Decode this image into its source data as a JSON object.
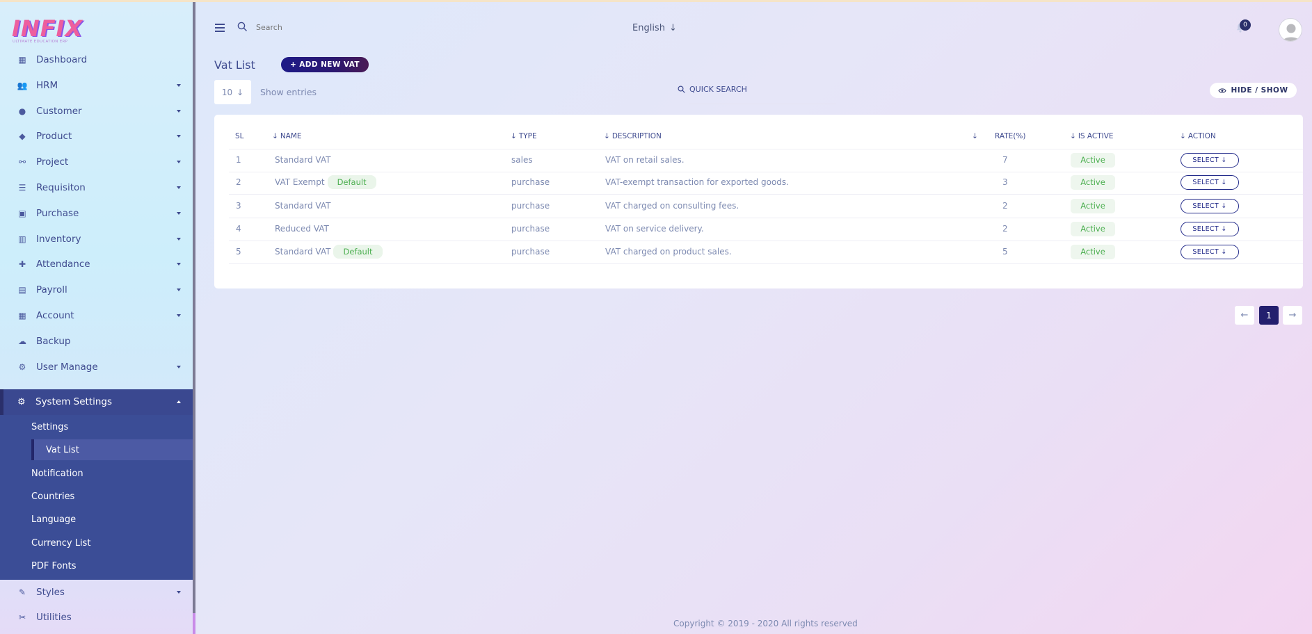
{
  "brand": {
    "logo_text": "INFIX",
    "tagline": "ULTIMATE EDUCATION ERP"
  },
  "sidebar": {
    "items": [
      {
        "label": "Dashboard",
        "icon": "grid-icon",
        "has_caret": false
      },
      {
        "label": "HRM",
        "icon": "users-icon",
        "has_caret": true
      },
      {
        "label": "Customer",
        "icon": "user-icon",
        "has_caret": true
      },
      {
        "label": "Product",
        "icon": "tags-icon",
        "has_caret": true
      },
      {
        "label": "Project",
        "icon": "project-diagram-icon",
        "has_caret": true
      },
      {
        "label": "Requisiton",
        "icon": "list-icon",
        "has_caret": true
      },
      {
        "label": "Purchase",
        "icon": "truck-loading-icon",
        "has_caret": true
      },
      {
        "label": "Inventory",
        "icon": "barcode-icon",
        "has_caret": true
      },
      {
        "label": "Attendance",
        "icon": "user-plus-icon",
        "has_caret": true
      },
      {
        "label": "Payroll",
        "icon": "money-icon",
        "has_caret": true
      },
      {
        "label": "Account",
        "icon": "calculator-icon",
        "has_caret": true
      },
      {
        "label": "Backup",
        "icon": "cloud-download-icon",
        "has_caret": false
      },
      {
        "label": "User Manage",
        "icon": "users-cog-icon",
        "has_caret": true
      }
    ],
    "system_settings": {
      "label": "System Settings",
      "icon": "gear-icon",
      "children": [
        "Settings",
        "Vat List",
        "Notification",
        "Countries",
        "Language",
        "Currency List",
        "PDF Fonts"
      ],
      "active_child": "Vat List"
    },
    "bottom_items": [
      {
        "label": "Styles",
        "icon": "paint-brush-icon",
        "has_caret": true
      },
      {
        "label": "Utilities",
        "icon": "tools-icon",
        "has_caret": false
      }
    ]
  },
  "header": {
    "search_placeholder": "Search",
    "language": "English",
    "notification_count": "0"
  },
  "main": {
    "title": "Vat List",
    "add_button": "+ ADD NEW VAT",
    "entries_value": "10",
    "show_entries": "Show entries",
    "quick_search": "QUICK SEARCH",
    "hide_show": "HIDE / SHOW"
  },
  "table": {
    "columns": [
      "SL",
      "NAME",
      "TYPE",
      "DESCRIPTION",
      "",
      "RATE(%)",
      "IS ACTIVE",
      "ACTION"
    ],
    "rows": [
      {
        "sl": "1",
        "name": "Standard VAT",
        "default": false,
        "type": "sales",
        "description": "VAT on retail sales.",
        "rate": "7",
        "status": "Active",
        "action": "SELECT"
      },
      {
        "sl": "2",
        "name": "VAT Exempt",
        "default": true,
        "type": "purchase",
        "description": "VAT-exempt transaction for exported goods.",
        "rate": "3",
        "status": "Active",
        "action": "SELECT"
      },
      {
        "sl": "3",
        "name": "Standard VAT",
        "default": false,
        "type": "purchase",
        "description": "VAT charged on consulting fees.",
        "rate": "2",
        "status": "Active",
        "action": "SELECT"
      },
      {
        "sl": "4",
        "name": "Reduced VAT",
        "default": false,
        "type": "purchase",
        "description": "VAT on service delivery.",
        "rate": "2",
        "status": "Active",
        "action": "SELECT"
      },
      {
        "sl": "5",
        "name": "Standard VAT",
        "default": true,
        "type": "purchase",
        "description": "VAT charged on product sales.",
        "rate": "5",
        "status": "Active",
        "action": "SELECT"
      }
    ],
    "default_badge": "Default"
  },
  "pagination": {
    "current": "1"
  },
  "footer": {
    "copyright": "Copyright © 2019 - 2020 All rights reserved"
  },
  "colors": {
    "accent": "#231f6e",
    "sidebar_active": "#3b4d96",
    "success": "#4caf50"
  }
}
